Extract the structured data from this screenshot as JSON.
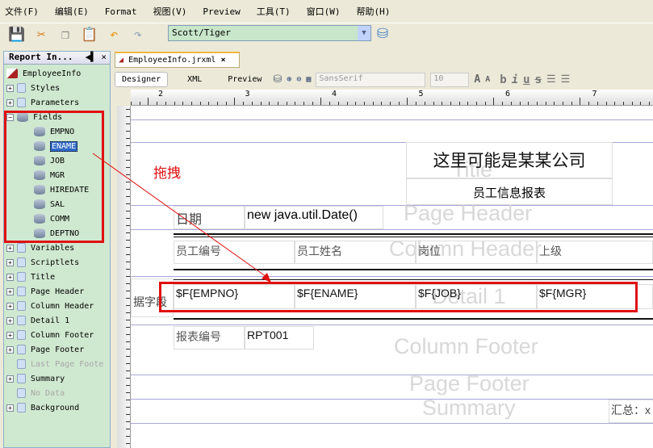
{
  "menu": [
    "文件(F)",
    "编辑(E)",
    "Format",
    "视图(V)",
    "Preview",
    "工具(T)",
    "窗口(W)",
    "帮助(H)"
  ],
  "toolbar": {
    "connection": "Scott/Tiger"
  },
  "panel": {
    "title": "Report In...",
    "root": "EmployeeInfo",
    "items": [
      {
        "label": "Styles",
        "type": "style"
      },
      {
        "label": "Parameters",
        "type": "param"
      },
      {
        "label": "Fields",
        "type": "db"
      }
    ],
    "fields": [
      "EMPNO",
      "ENAME",
      "JOB",
      "MGR",
      "HIREDATE",
      "SAL",
      "COMM",
      "DEPTNO"
    ],
    "selected_field": "ENAME",
    "sections": [
      {
        "label": "Variables",
        "dim": false
      },
      {
        "label": "Scriptlets",
        "dim": false
      },
      {
        "label": "Title",
        "dim": false
      },
      {
        "label": "Page Header",
        "dim": false
      },
      {
        "label": "Column Header",
        "dim": false
      },
      {
        "label": "Detail 1",
        "dim": false
      },
      {
        "label": "Column Footer",
        "dim": false
      },
      {
        "label": "Page Footer",
        "dim": false
      },
      {
        "label": "Last Page Foote",
        "dim": true
      },
      {
        "label": "Summary",
        "dim": false
      },
      {
        "label": "No Data",
        "dim": true
      },
      {
        "label": "Background",
        "dim": false
      }
    ]
  },
  "editor": {
    "tab": "EmployeeInfo.jrxml",
    "views": [
      "Designer",
      "XML",
      "Preview"
    ],
    "font": "SansSerif",
    "size": "10",
    "ruler": [
      "2",
      "3",
      "4",
      "5",
      "6",
      "7"
    ]
  },
  "report": {
    "company": "这里可能是某某公司",
    "subtitle": "员工信息报表",
    "drag_note": "拖拽",
    "date_label": "日期",
    "date_expr": "new java.util.Date()",
    "columns": [
      "员工编号",
      "员工姓名",
      "岗位",
      "上级"
    ],
    "detail": [
      "$F{EMPNO}",
      "$F{ENAME}",
      "$F{JOB}",
      "$F{MGR}"
    ],
    "detail_side": "据字段",
    "footer_label": "报表编号",
    "footer_value": "RPT001",
    "summary": "汇总：x",
    "bands": [
      "Title",
      "Page Header",
      "Column Header",
      "Detail 1",
      "Column Footer",
      "Page Footer",
      "Summary"
    ]
  },
  "colors": {
    "annotation": "#e01010"
  }
}
